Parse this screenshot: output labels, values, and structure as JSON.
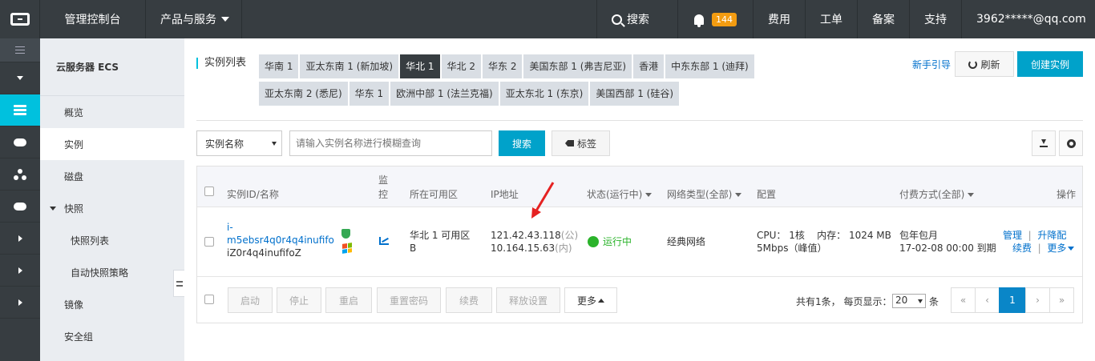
{
  "topbar": {
    "console": "管理控制台",
    "products": "产品与服务",
    "search": "搜索",
    "notifications": "144",
    "fee": "费用",
    "ticket": "工单",
    "record": "备案",
    "support": "支持",
    "user": "3962*****@qq.com"
  },
  "subnav": {
    "title": "云服务器 ECS",
    "items": [
      "概览",
      "实例",
      "磁盘",
      "快照",
      "快照列表",
      "自动快照策略",
      "镜像",
      "安全组"
    ]
  },
  "main": {
    "header": "实例列表",
    "regions": [
      "华南 1",
      "亚太东南 1 (新加坡)",
      "华北 1",
      "华北 2",
      "华东 2",
      "美国东部 1 (弗吉尼亚)",
      "香港",
      "中东东部 1 (迪拜)",
      "亚太东南 2 (悉尼)",
      "华东 1",
      "欧洲中部 1 (法兰克福)",
      "亚太东北 1 (东京)",
      "美国西部 1 (硅谷)"
    ],
    "active_region": "华北 1",
    "guide": "新手引导",
    "refresh": "刷新",
    "create": "创建实例",
    "filter": "实例名称",
    "search_placeholder": "请输入实例名称进行模糊查询",
    "search_btn": "搜索",
    "tag_btn": "标签"
  },
  "table": {
    "headers": {
      "id": "实例ID/名称",
      "monitor": "监控",
      "zone": "所在可用区",
      "ip": "IP地址",
      "status": "状态(运行中)",
      "network": "网络类型(全部)",
      "config": "配置",
      "billing": "付费方式(全部)",
      "ops": "操作"
    },
    "row": {
      "id1": "i-",
      "id2": "m5ebsr4q0r4q4inufifo",
      "name": "iZ0r4q4inufifoZ",
      "zone1": "华北 1 可用区",
      "zone2": "B",
      "ip_public": "121.42.43.118",
      "ip_public_tag": "(公)",
      "ip_private": "10.164.15.63",
      "ip_private_tag": "(内)",
      "status": "运行中",
      "network": "经典网络",
      "cpu": "CPU： 1核",
      "mem": "内存： 1024 MB",
      "bw": "5Mbps（峰值）",
      "billing": "包年包月",
      "expire": "17-02-08 00:00 到期",
      "op_manage": "管理",
      "op_upgrade": "升降配",
      "op_renew": "续费",
      "op_more": "更多"
    },
    "footer_buttons": [
      "启动",
      "停止",
      "重启",
      "重置密码",
      "续费",
      "释放设置",
      "更多"
    ],
    "total": "共有1条， 每页显示：",
    "page_size": "20",
    "per": "条",
    "pager": [
      "«",
      "‹",
      "1",
      "›",
      "»"
    ]
  },
  "colors": {
    "accent": "#00c1de",
    "primary_button": "#00a2ca",
    "topbar": "#373d41",
    "running": "#2bb32b",
    "arrow": "#e52222"
  }
}
